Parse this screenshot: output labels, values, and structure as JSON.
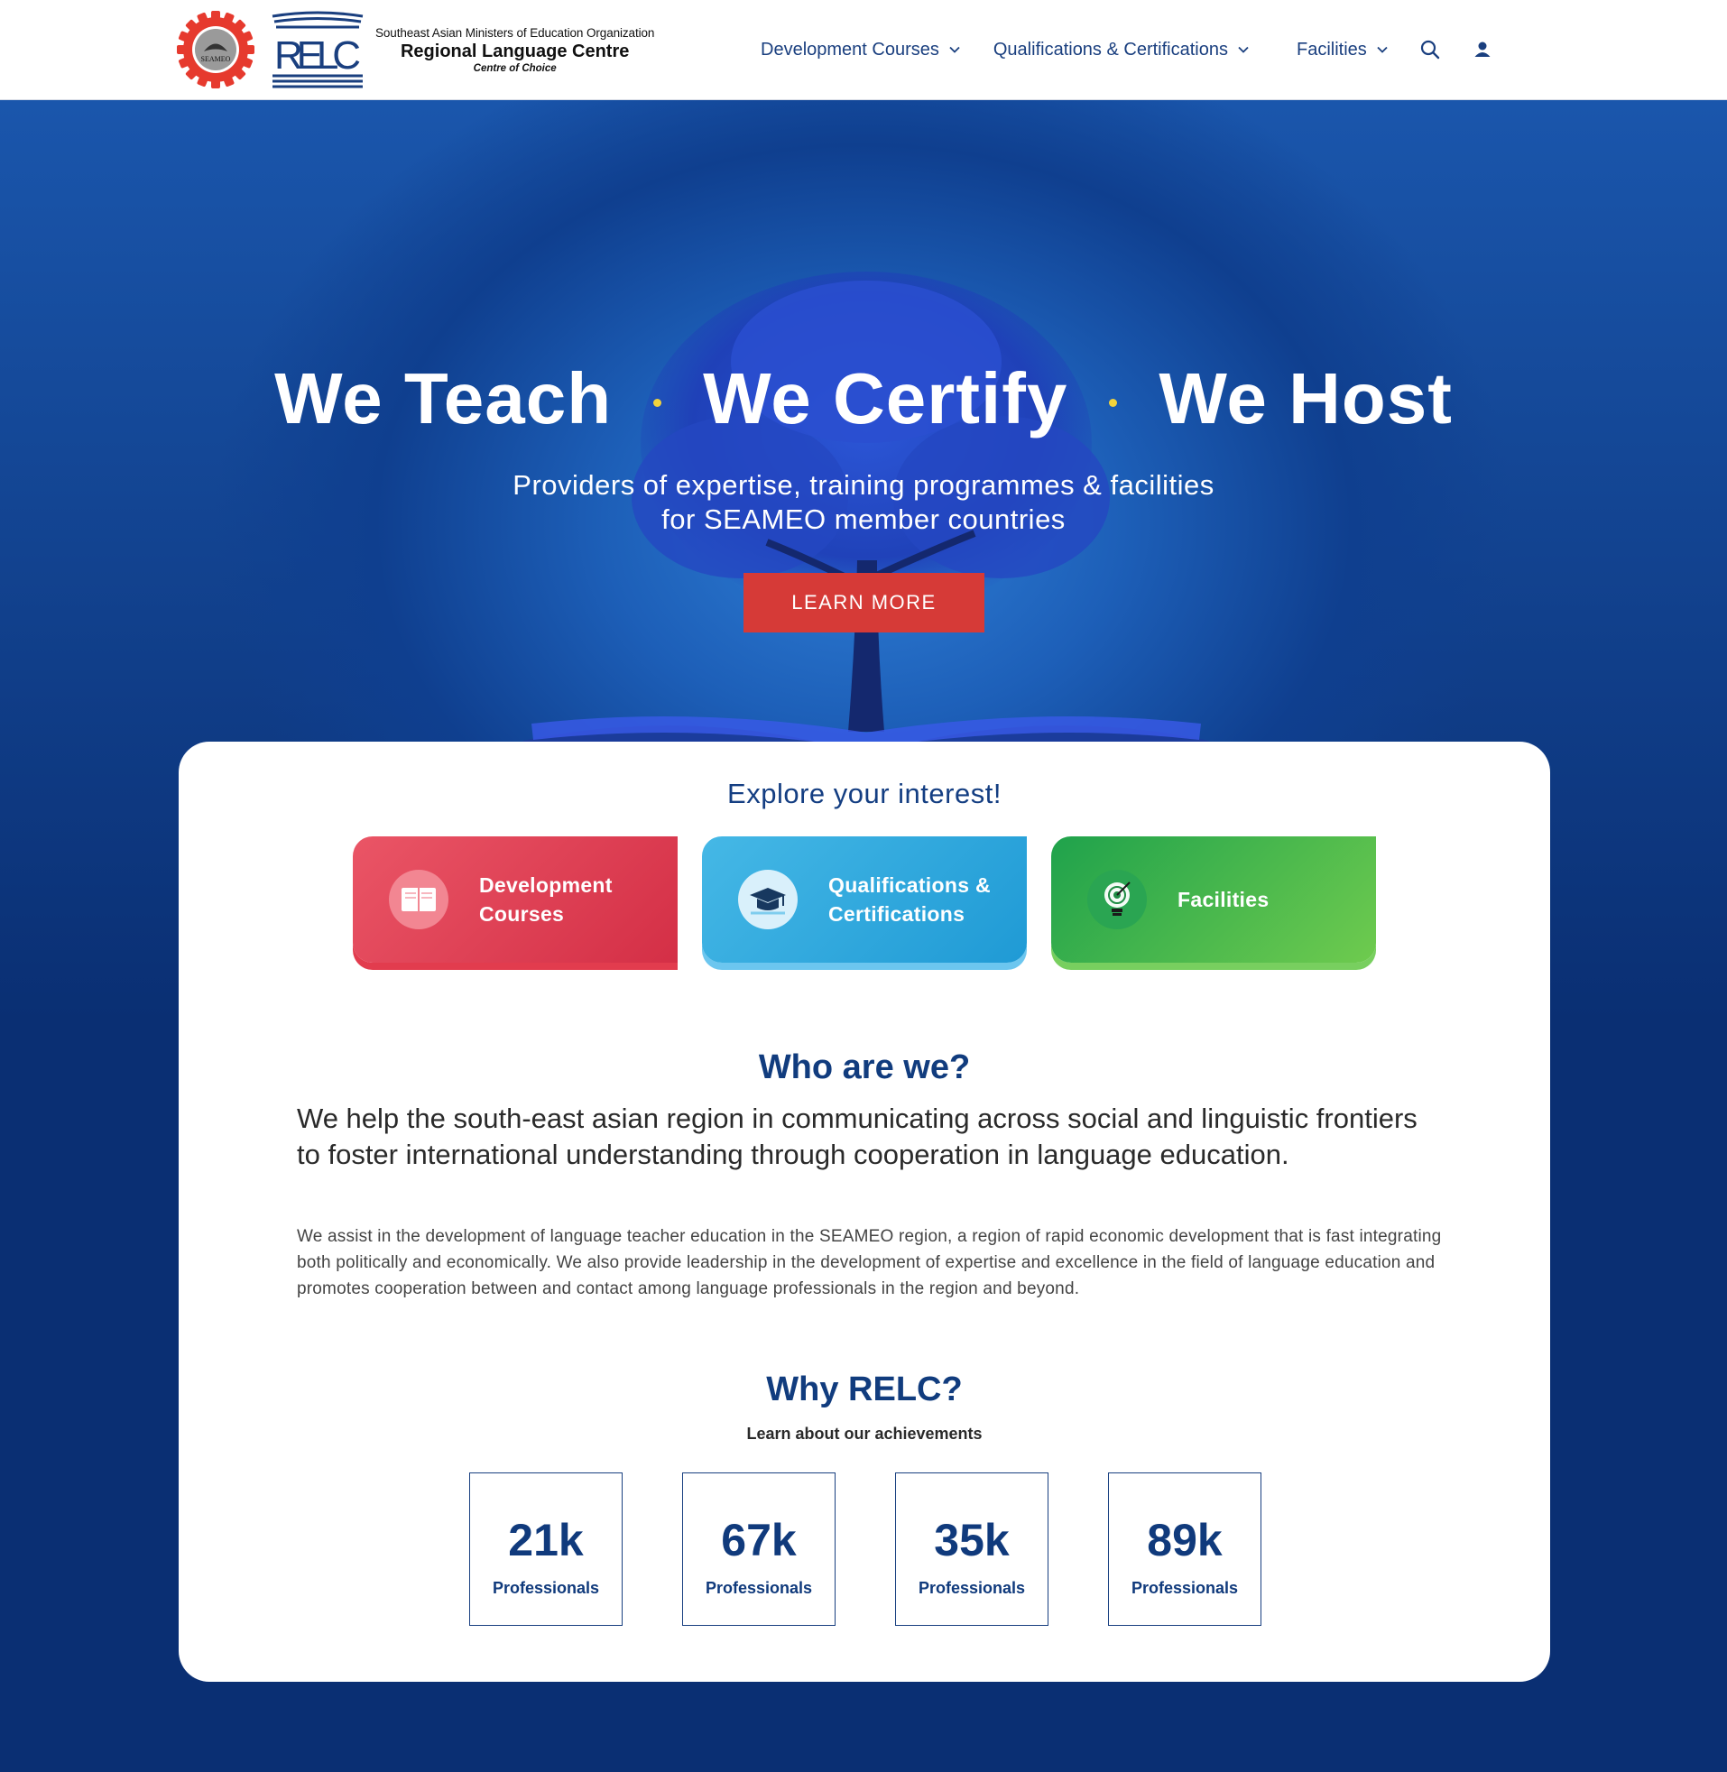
{
  "header": {
    "org_name": "Southeast Asian Ministers of Education Organization",
    "centre_name": "Regional Language Centre",
    "tagline": "Centre of Choice",
    "relc_logo_text": "RELC",
    "seameo_logo_text": "SEAMEO",
    "nav": [
      {
        "label": "Development Courses",
        "icon": "chevron-down-icon"
      },
      {
        "label": "Qualifications & Certifications",
        "icon": "chevron-down-icon"
      },
      {
        "label": "Facilities",
        "icon": "chevron-down-icon"
      }
    ],
    "search_icon": "search-icon",
    "account_icon": "user-icon"
  },
  "hero": {
    "title_parts": [
      "We Teach",
      "We Certify",
      "We Host"
    ],
    "subtitle_line1": "Providers of expertise, training programmes & facilities",
    "subtitle_line2": "for SEAMEO member countries",
    "cta_label": "LEARN MORE"
  },
  "explore": {
    "title": "Explore your interest!",
    "tiles": [
      {
        "line1": "Development",
        "line2": "Courses",
        "icon": "book-icon",
        "color": "#e0404f"
      },
      {
        "line1": "Qualifications &",
        "line2": "Certifications",
        "icon": "graduation-cap-icon",
        "color": "#2fa8dd"
      },
      {
        "line1": "Facilities",
        "line2": "",
        "icon": "lightbulb-target-icon",
        "color": "#3cb44c"
      }
    ]
  },
  "who": {
    "title": "Who are we?",
    "lead": "We help the south-east asian region in communicating across social and linguistic frontiers to foster international understanding through cooperation in language education.",
    "body": "We assist in the development of language teacher education in the SEAMEO region, a region of rapid economic development that is fast integrating both politically and economically. We also provide leadership in the development of expertise and excellence in the field of language education and promotes cooperation between and contact among language professionals in the region and beyond."
  },
  "why": {
    "title": "Why RELC?",
    "subtitle": "Learn about our achievements",
    "stats": [
      {
        "value": "21k",
        "label": "Professionals"
      },
      {
        "value": "67k",
        "label": "Professionals"
      },
      {
        "value": "35k",
        "label": "Professionals"
      },
      {
        "value": "89k",
        "label": "Professionals"
      }
    ]
  },
  "colors": {
    "navy": "#0a2f73",
    "nav_text": "#1a3f7f",
    "cta": "#d63a37",
    "accent_dot": "#f2d33c"
  }
}
